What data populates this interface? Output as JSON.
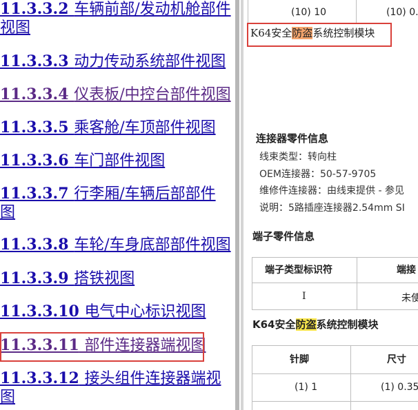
{
  "nav": {
    "items": [
      {
        "num": "11.3.3.2",
        "title_line1": "车辆前部/发动机舱部件",
        "title_line2": "视图"
      },
      {
        "num": "11.3.3.3",
        "title": "动力传动系统部件视图"
      },
      {
        "num": "11.3.3.4",
        "title": "仪表板/中控台部件视图"
      },
      {
        "num": "11.3.3.5",
        "title": "乘客舱/车顶部件视图"
      },
      {
        "num": "11.3.3.6",
        "title": "车门部件视图"
      },
      {
        "num": "11.3.3.7",
        "title_line1": "行李厢/车辆后部部件",
        "title_line2": "图"
      },
      {
        "num": "11.3.3.8",
        "title": "车轮/车身底部部件视图"
      },
      {
        "num": "11.3.3.9",
        "title": "搭铁视图"
      },
      {
        "num": "11.3.3.10",
        "title": "电气中心标识视图"
      },
      {
        "num": "11.3.3.11",
        "title": "部件连接器端视图"
      },
      {
        "num": "11.3.3.12",
        "title_line1": "接头组件连接器端视",
        "title_line2": "图"
      }
    ]
  },
  "content": {
    "top_row": {
      "left": "(10) 10",
      "right": "(10) 0."
    },
    "module_title": {
      "pre": "K64安全",
      "highlight": "防盗",
      "post": "系统控制模块"
    },
    "connector_info": {
      "heading": "连接器零件信息",
      "lines": [
        "线束类型：转向柱",
        "OEM连接器：50-57-9705",
        "维修件连接器：由线束提供 - 参见",
        "说明：5路插座连接器2.54mm SI"
      ]
    },
    "terminal_info": {
      "heading": "端子零件信息",
      "headers": [
        "端子类型标识符",
        "端接"
      ],
      "row": [
        "I",
        "未使"
      ]
    },
    "module_title_2": {
      "pre": "K64安全",
      "highlight": "防盗",
      "post": "系统控制模块"
    },
    "pin_table": {
      "headers": [
        "针脚",
        "尺寸"
      ],
      "row": [
        "(1) 1",
        "(1) 0.35"
      ]
    }
  },
  "colors": {
    "link": "#1a0dab",
    "visited_link": "#5b2a86",
    "highlight_box": "#d9403a",
    "search_highlight_current": "#f4a46c",
    "search_highlight": "#f7e44a"
  }
}
